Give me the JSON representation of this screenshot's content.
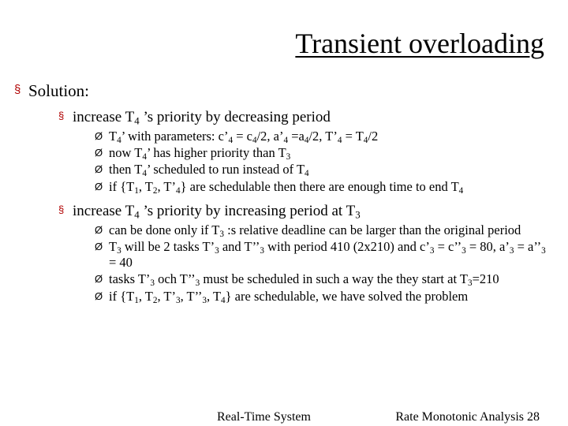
{
  "title": "Transient overloading",
  "solution_label": "Solution:",
  "sectionA": {
    "heading_html": "increase T<sub>4</sub> &rsquo;s priority by decreasing period",
    "items": [
      "T<sub>4</sub>&rsquo; with parameters: c&rsquo;<sub>4</sub> = c<sub>4</sub>/2, a&rsquo;<sub>4</sub> =a<sub>4</sub>/2, T&rsquo;<sub>4</sub> = T<sub>4</sub>/2",
      "now T<sub>4</sub>&rsquo; has higher priority than T<sub>3</sub>",
      "then T<sub>4</sub>&rsquo; scheduled to run instead of T<sub>4</sub>",
      "if {T<sub>1</sub>, T<sub>2</sub>, T&rsquo;<sub>4</sub>} are schedulable then there are enough time to end T<sub>4</sub>"
    ]
  },
  "sectionB": {
    "heading_html": "increase T<sub>4</sub> &rsquo;s priority by increasing period at T<sub>3</sub>",
    "items": [
      "can be done only if T<sub>3</sub> :s relative deadline can be larger than the original period",
      "T<sub>3</sub> will be 2 tasks T&rsquo;<sub>3</sub> and T&rsquo;&rsquo;<sub>3</sub> with period 410 (2x210) and c&rsquo;<sub>3</sub> = c&rsquo;&rsquo;<sub>3</sub> = 80, a&rsquo;<sub>3</sub> = a&rsquo;&rsquo;<sub>3</sub> = 40",
      "tasks T&rsquo;<sub>3</sub> och T&rsquo;&rsquo;<sub>3</sub> must be scheduled in such a way the they start at T<sub>3</sub>=210",
      "if {T<sub>1</sub>, T<sub>2</sub>, T&rsquo;<sub>3</sub>, T&rsquo;&rsquo;<sub>3</sub>, T<sub>4</sub>} are schedulable, we have solved the problem"
    ]
  },
  "footer_left": "Real-Time System",
  "footer_right": "Rate Monotonic Analysis 28",
  "bullets": {
    "lvl1": "§",
    "lvl2": "§",
    "lvl3": "Ø"
  }
}
